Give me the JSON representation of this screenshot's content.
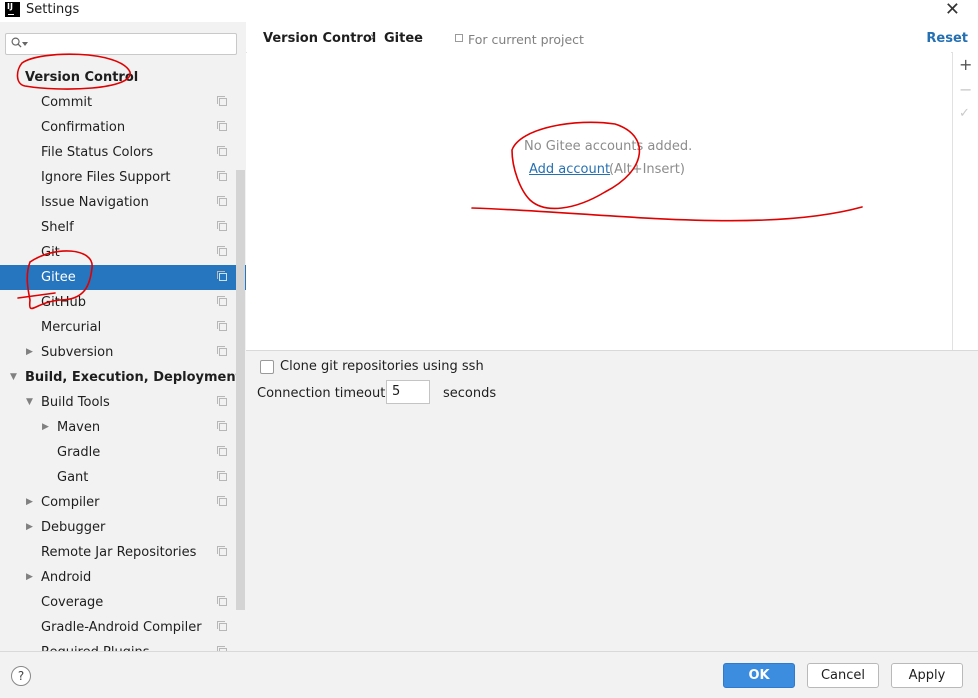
{
  "window": {
    "title": "Settings",
    "logo_text": "IJ"
  },
  "sidebar": {
    "search_placeholder": "",
    "items": [
      {
        "label": "Version Control",
        "level": 0,
        "bold": true,
        "arrow": "",
        "copy": false,
        "selected": false
      },
      {
        "label": "Commit",
        "level": 1,
        "arrow": "",
        "copy": true
      },
      {
        "label": "Confirmation",
        "level": 1,
        "arrow": "",
        "copy": true
      },
      {
        "label": "File Status Colors",
        "level": 1,
        "arrow": "",
        "copy": true
      },
      {
        "label": "Ignore Files Support",
        "level": 1,
        "arrow": "",
        "copy": true
      },
      {
        "label": "Issue Navigation",
        "level": 1,
        "arrow": "",
        "copy": true
      },
      {
        "label": "Shelf",
        "level": 1,
        "arrow": "",
        "copy": true
      },
      {
        "label": "Git",
        "level": 1,
        "arrow": "",
        "copy": true
      },
      {
        "label": "Gitee",
        "level": 1,
        "arrow": "",
        "copy": true,
        "selected": true
      },
      {
        "label": "GitHub",
        "level": 1,
        "arrow": "",
        "copy": true
      },
      {
        "label": "Mercurial",
        "level": 1,
        "arrow": "",
        "copy": true
      },
      {
        "label": "Subversion",
        "level": 1,
        "arrow": "collapsed",
        "copy": true
      },
      {
        "label": "Build, Execution, Deployment",
        "level": 0,
        "bold": true,
        "arrow": "expanded",
        "copy": false
      },
      {
        "label": "Build Tools",
        "level": 1,
        "arrow": "expanded",
        "copy": true
      },
      {
        "label": "Maven",
        "level": 2,
        "arrow": "collapsed",
        "copy": true
      },
      {
        "label": "Gradle",
        "level": 2,
        "arrow": "",
        "copy": true
      },
      {
        "label": "Gant",
        "level": 2,
        "arrow": "",
        "copy": true
      },
      {
        "label": "Compiler",
        "level": 1,
        "arrow": "collapsed",
        "copy": true
      },
      {
        "label": "Debugger",
        "level": 1,
        "arrow": "collapsed",
        "copy": false
      },
      {
        "label": "Remote Jar Repositories",
        "level": 1,
        "arrow": "",
        "copy": true
      },
      {
        "label": "Android",
        "level": 1,
        "arrow": "collapsed",
        "copy": false
      },
      {
        "label": "Coverage",
        "level": 1,
        "arrow": "",
        "copy": true
      },
      {
        "label": "Gradle-Android Compiler",
        "level": 1,
        "arrow": "",
        "copy": true
      },
      {
        "label": "Required Plugins",
        "level": 1,
        "arrow": "",
        "copy": true
      }
    ]
  },
  "header": {
    "breadcrumb_parent": "Version Control",
    "breadcrumb_separator": "›",
    "breadcrumb_current": "Gitee",
    "scope_text": "For current project",
    "reset_label": "Reset"
  },
  "accounts": {
    "empty_text": "No Gitee accounts added.",
    "add_link": "Add account",
    "add_shortcut": "(Alt+Insert)",
    "toolbar": {
      "add": "+",
      "remove": "−",
      "set_default": "✓"
    }
  },
  "options": {
    "clone_ssh_label": "Clone git repositories using ssh",
    "clone_ssh_checked": false,
    "timeout_label": "Connection timeout:",
    "timeout_value": "5",
    "timeout_unit": "seconds"
  },
  "footer": {
    "help": "?",
    "ok": "OK",
    "cancel": "Cancel",
    "apply": "Apply"
  },
  "colors": {
    "selection": "#2675bf",
    "link": "#2470b3",
    "primary_button": "#3c8ce0",
    "annotation": "#e00000"
  }
}
